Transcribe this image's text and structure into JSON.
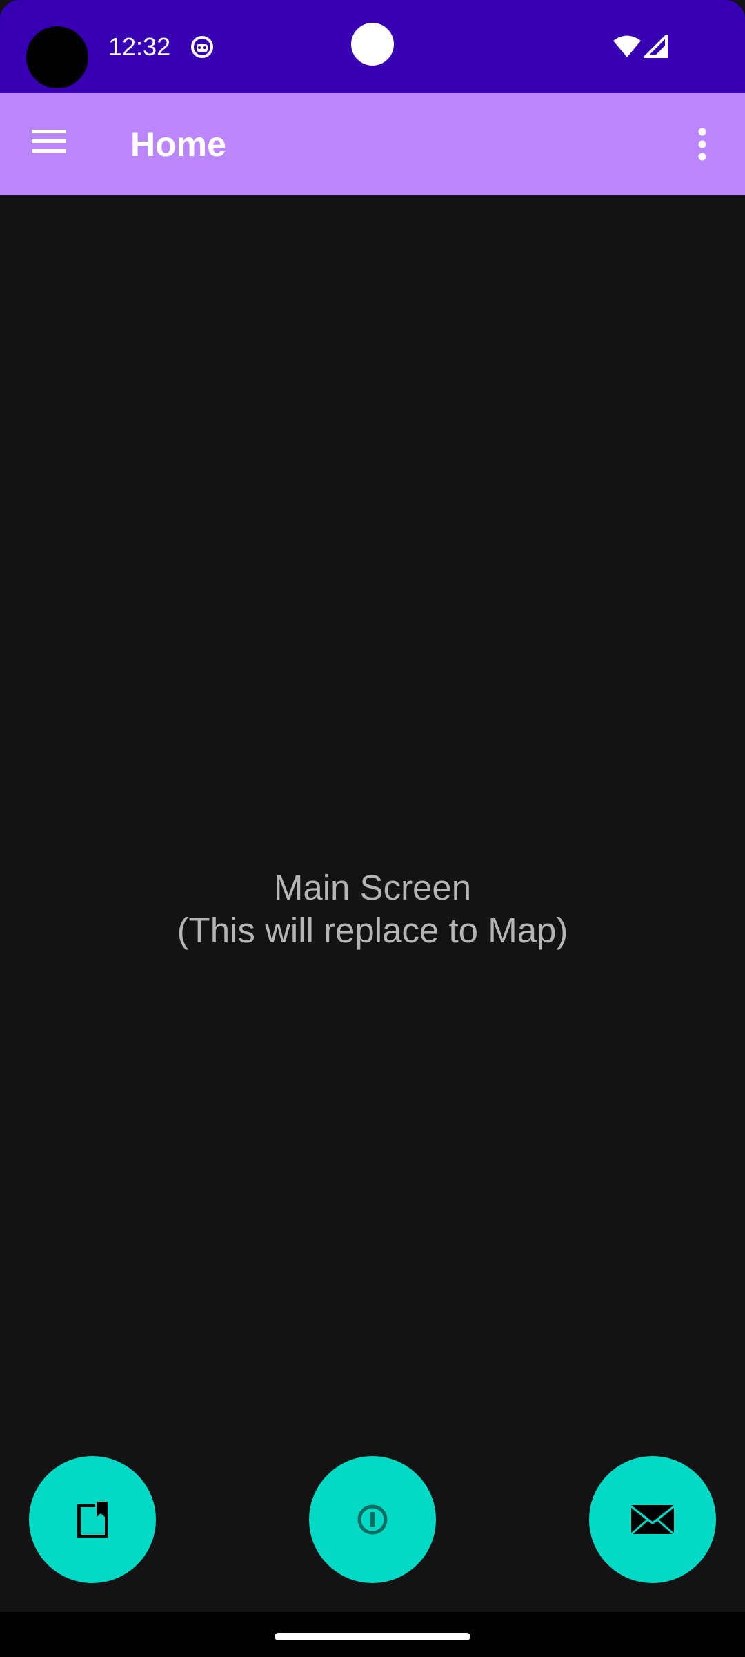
{
  "status_bar": {
    "time": "12:32",
    "icons": [
      "camera-cutout",
      "app-notification-icon",
      "wifi-icon",
      "cell-signal-icon"
    ],
    "color": "#3700b3"
  },
  "app_bar": {
    "title": "Home",
    "menu_icon": "hamburger-menu-icon",
    "overflow_icon": "more-vert-icon",
    "color": "#bb86fc"
  },
  "main": {
    "line1": "Main Screen",
    "line2": "(This will replace to Map)",
    "text_color": "#b5b5b5",
    "background": "#131313"
  },
  "fabs": [
    {
      "icon": "bookmark-book-icon"
    },
    {
      "icon": "info-circle-icon"
    },
    {
      "icon": "mail-icon"
    }
  ],
  "accent": "#03dac5"
}
